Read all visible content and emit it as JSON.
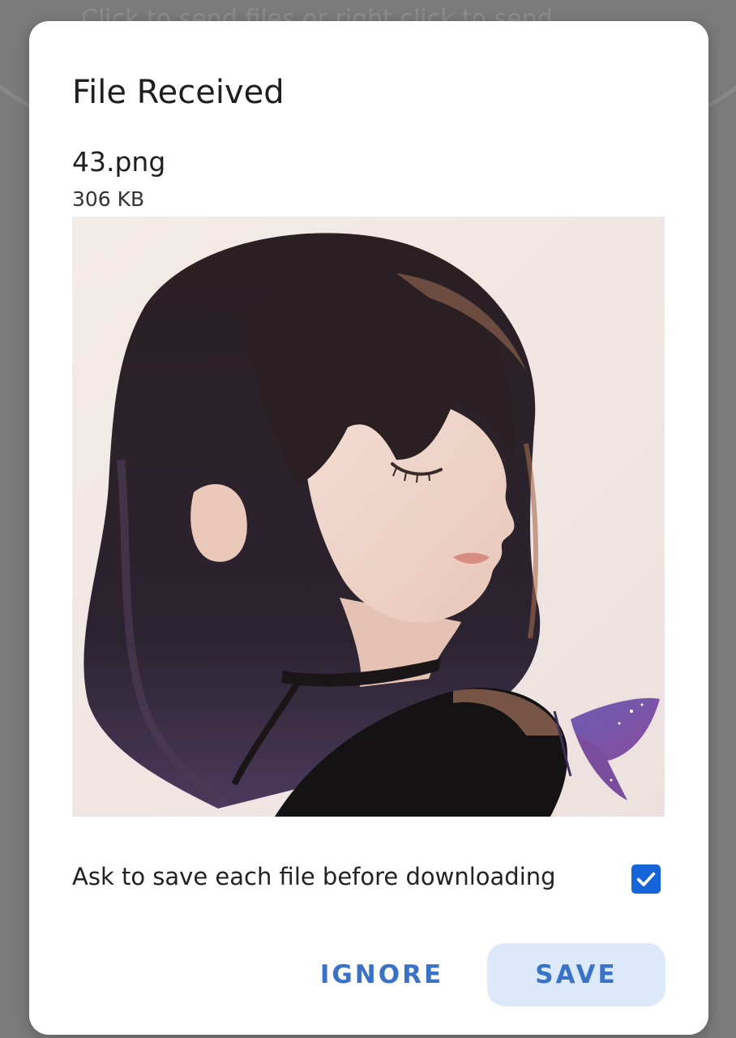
{
  "background": {
    "hint_text": "Click to send files or right click to send"
  },
  "dialog": {
    "title": "File Received",
    "file_name": "43.png",
    "file_size": "306 KB",
    "preview_alt": "Illustration of a girl with short dark hair, eyes closed, and a purple butterfly",
    "ask_label": "Ask to save each file before downloading",
    "ask_checked": true,
    "ignore_label": "IGNORE",
    "save_label": "SAVE"
  },
  "colors": {
    "accent": "#1565d8",
    "button_text": "#3a72c7",
    "save_button_bg": "#dce9fb"
  }
}
